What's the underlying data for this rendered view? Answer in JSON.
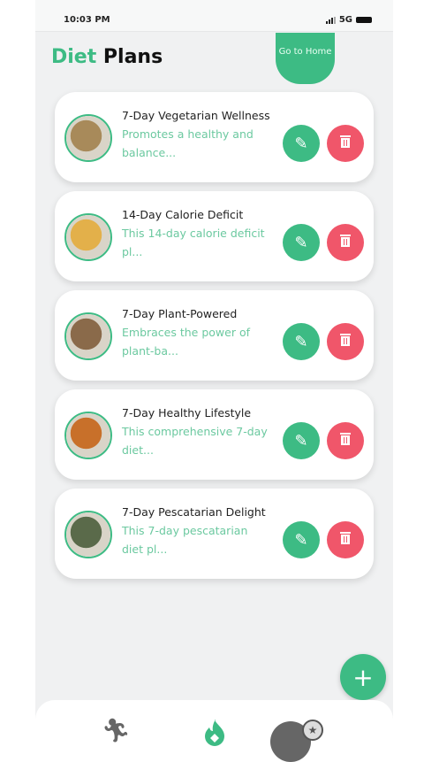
{
  "status": {
    "time": "10:03 PM",
    "network": "5G"
  },
  "header": {
    "title_accent": "Diet",
    "title_rest": "Plans",
    "home_button": "Go to Home"
  },
  "plans": [
    {
      "name": "7-Day Vegetarian Wellness",
      "description": "Promotes a healthy and balance...",
      "color": "#a88a5a"
    },
    {
      "name": "14-Day Calorie Deficit",
      "description": "This 14-day calorie deficit pl...",
      "color": "#e3b04a"
    },
    {
      "name": "7-Day Plant-Powered",
      "description": "Embraces the power of plant-ba...",
      "color": "#8a6a4a"
    },
    {
      "name": "7-Day Healthy Lifestyle",
      "description": "This comprehensive 7-day diet...",
      "color": "#c8702a"
    },
    {
      "name": "7-Day Pescatarian Delight",
      "description": "This 7-day pescatarian diet pl...",
      "color": "#5a6a4a"
    }
  ],
  "colors": {
    "accent": "#3dbb84",
    "danger": "#f0566a"
  },
  "icons": {
    "edit": "pencil-icon",
    "delete": "trash-icon",
    "add": "plus-icon",
    "nav": [
      "running-icon",
      "flame-icon",
      "badge-icon"
    ]
  }
}
